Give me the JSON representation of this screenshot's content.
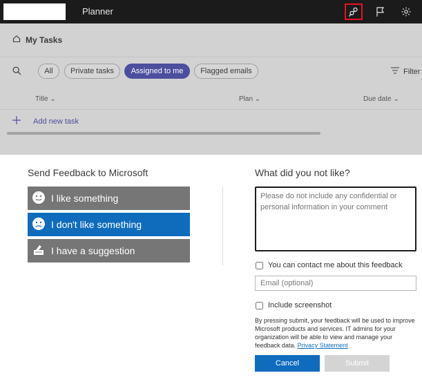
{
  "app": {
    "title": "Planner"
  },
  "topbar": {
    "icons": [
      "feedback-icon",
      "flag-icon",
      "settings-icon"
    ]
  },
  "page": {
    "title": "My Tasks"
  },
  "filters": {
    "pills": [
      "All",
      "Private tasks",
      "Assigned to me",
      "Flagged emails"
    ],
    "active": "Assigned to me",
    "filter_label": "Filter"
  },
  "columns": {
    "title": "Title",
    "plan": "Plan",
    "due": "Due date"
  },
  "add_task": "Add new task",
  "dialog": {
    "left_title": "Send Feedback to Microsoft",
    "options": [
      {
        "label": "I like something",
        "icon": "smile-icon"
      },
      {
        "label": "I don't like something",
        "icon": "frown-icon"
      },
      {
        "label": "I have a suggestion",
        "icon": "suggestion-icon"
      }
    ],
    "right_title": "What did you not like?",
    "comment_placeholder": "Please do not include any confidential or personal information in your comment",
    "contact_label": "You can contact me about this feedback",
    "email_placeholder": "Email (optional)",
    "screenshot_label": "Include screenshot",
    "disclaimer": "By pressing submit, your feedback will be used to improve Microsoft products and services. IT admins for your organization will be able to view and manage your feedback data.",
    "privacy_link": "Privacy Statement",
    "cancel": "Cancel",
    "submit": "Submit"
  },
  "colors": {
    "accent": "#0f6cbd",
    "active_pill": "#4b4f9e",
    "topbar": "#1b1b1b",
    "highlight": "#e81123"
  }
}
